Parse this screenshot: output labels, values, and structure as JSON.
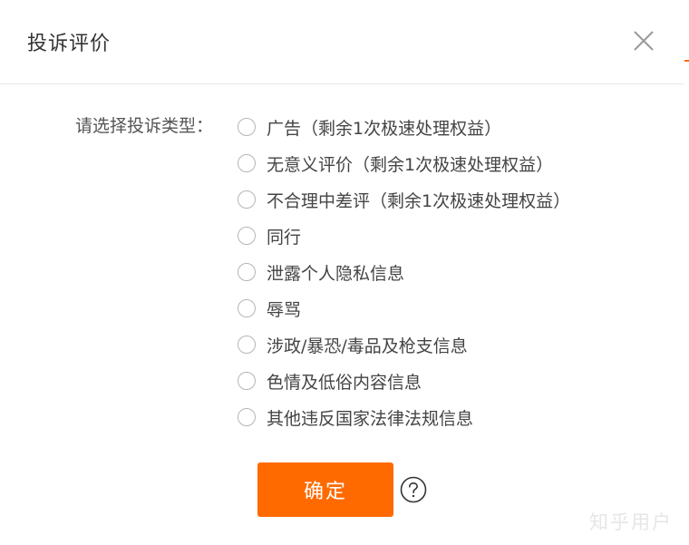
{
  "dialog": {
    "title": "投诉评价",
    "close_icon": "close-icon",
    "form": {
      "label": "请选择投诉类型：",
      "options": [
        {
          "label": "广告（剩余1次极速处理权益）",
          "selected": false
        },
        {
          "label": "无意义评价（剩余1次极速处理权益）",
          "selected": false
        },
        {
          "label": "不合理中差评（剩余1次极速处理权益）",
          "selected": false
        },
        {
          "label": "同行",
          "selected": false
        },
        {
          "label": "泄露个人隐私信息",
          "selected": false
        },
        {
          "label": "辱骂",
          "selected": false
        },
        {
          "label": "涉政/暴恐/毒品及枪支信息",
          "selected": false
        },
        {
          "label": "色情及低俗内容信息",
          "selected": false
        },
        {
          "label": "其他违反国家法律法规信息",
          "selected": false
        }
      ]
    },
    "confirm_label": "确定",
    "help_icon": "question-circle-icon"
  },
  "watermark": "知乎用户",
  "colors": {
    "accent": "#ff6a00",
    "text": "#444444",
    "radio_border": "#b5b5b5"
  }
}
